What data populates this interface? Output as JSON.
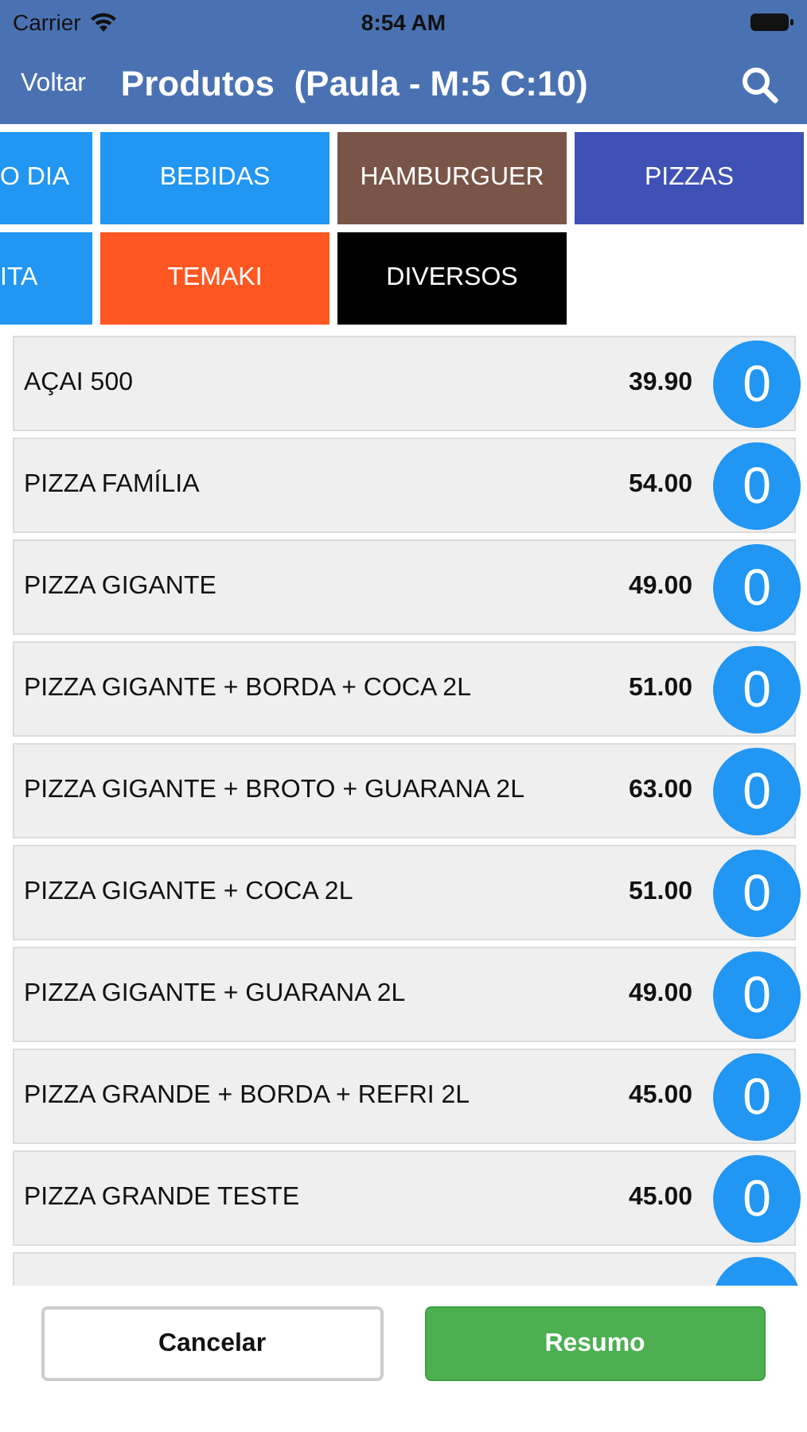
{
  "status_bar": {
    "carrier": "Carrier",
    "time": "8:54 AM"
  },
  "nav": {
    "back": "Voltar",
    "title": "Produtos  (Paula - M:5 C:10)"
  },
  "categories": [
    {
      "label": "O DIA",
      "color": "#2196f3",
      "kind": "cut"
    },
    {
      "label": "BEBIDAS",
      "color": "#2196f3",
      "kind": "full"
    },
    {
      "label": "HAMBURGUER",
      "color": "#795548",
      "kind": "full"
    },
    {
      "label": "PIZZAS",
      "color": "#3f51b5",
      "kind": "full"
    },
    {
      "label": "ITA",
      "color": "#2196f3",
      "kind": "cut"
    },
    {
      "label": "TEMAKI",
      "color": "#ff5722",
      "kind": "full"
    },
    {
      "label": "DIVERSOS",
      "color": "#000000",
      "kind": "full"
    }
  ],
  "products": [
    {
      "name": "AÇAI 500",
      "price": "39.90",
      "qty": "0"
    },
    {
      "name": "PIZZA FAMÍLIA",
      "price": "54.00",
      "qty": "0"
    },
    {
      "name": "PIZZA GIGANTE",
      "price": "49.00",
      "qty": "0"
    },
    {
      "name": "PIZZA GIGANTE + BORDA + COCA 2L",
      "price": "51.00",
      "qty": "0"
    },
    {
      "name": "PIZZA GIGANTE + BROTO + GUARANA 2L",
      "price": "63.00",
      "qty": "0"
    },
    {
      "name": "PIZZA GIGANTE + COCA 2L",
      "price": "51.00",
      "qty": "0"
    },
    {
      "name": "PIZZA GIGANTE + GUARANA 2L",
      "price": "49.00",
      "qty": "0"
    },
    {
      "name": "PIZZA GRANDE + BORDA + REFRI 2L",
      "price": "45.00",
      "qty": "0"
    },
    {
      "name": "PIZZA GRANDE TESTE",
      "price": "45.00",
      "qty": "0"
    }
  ],
  "buttons": {
    "cancel": "Cancelar",
    "confirm": "Resumo"
  }
}
